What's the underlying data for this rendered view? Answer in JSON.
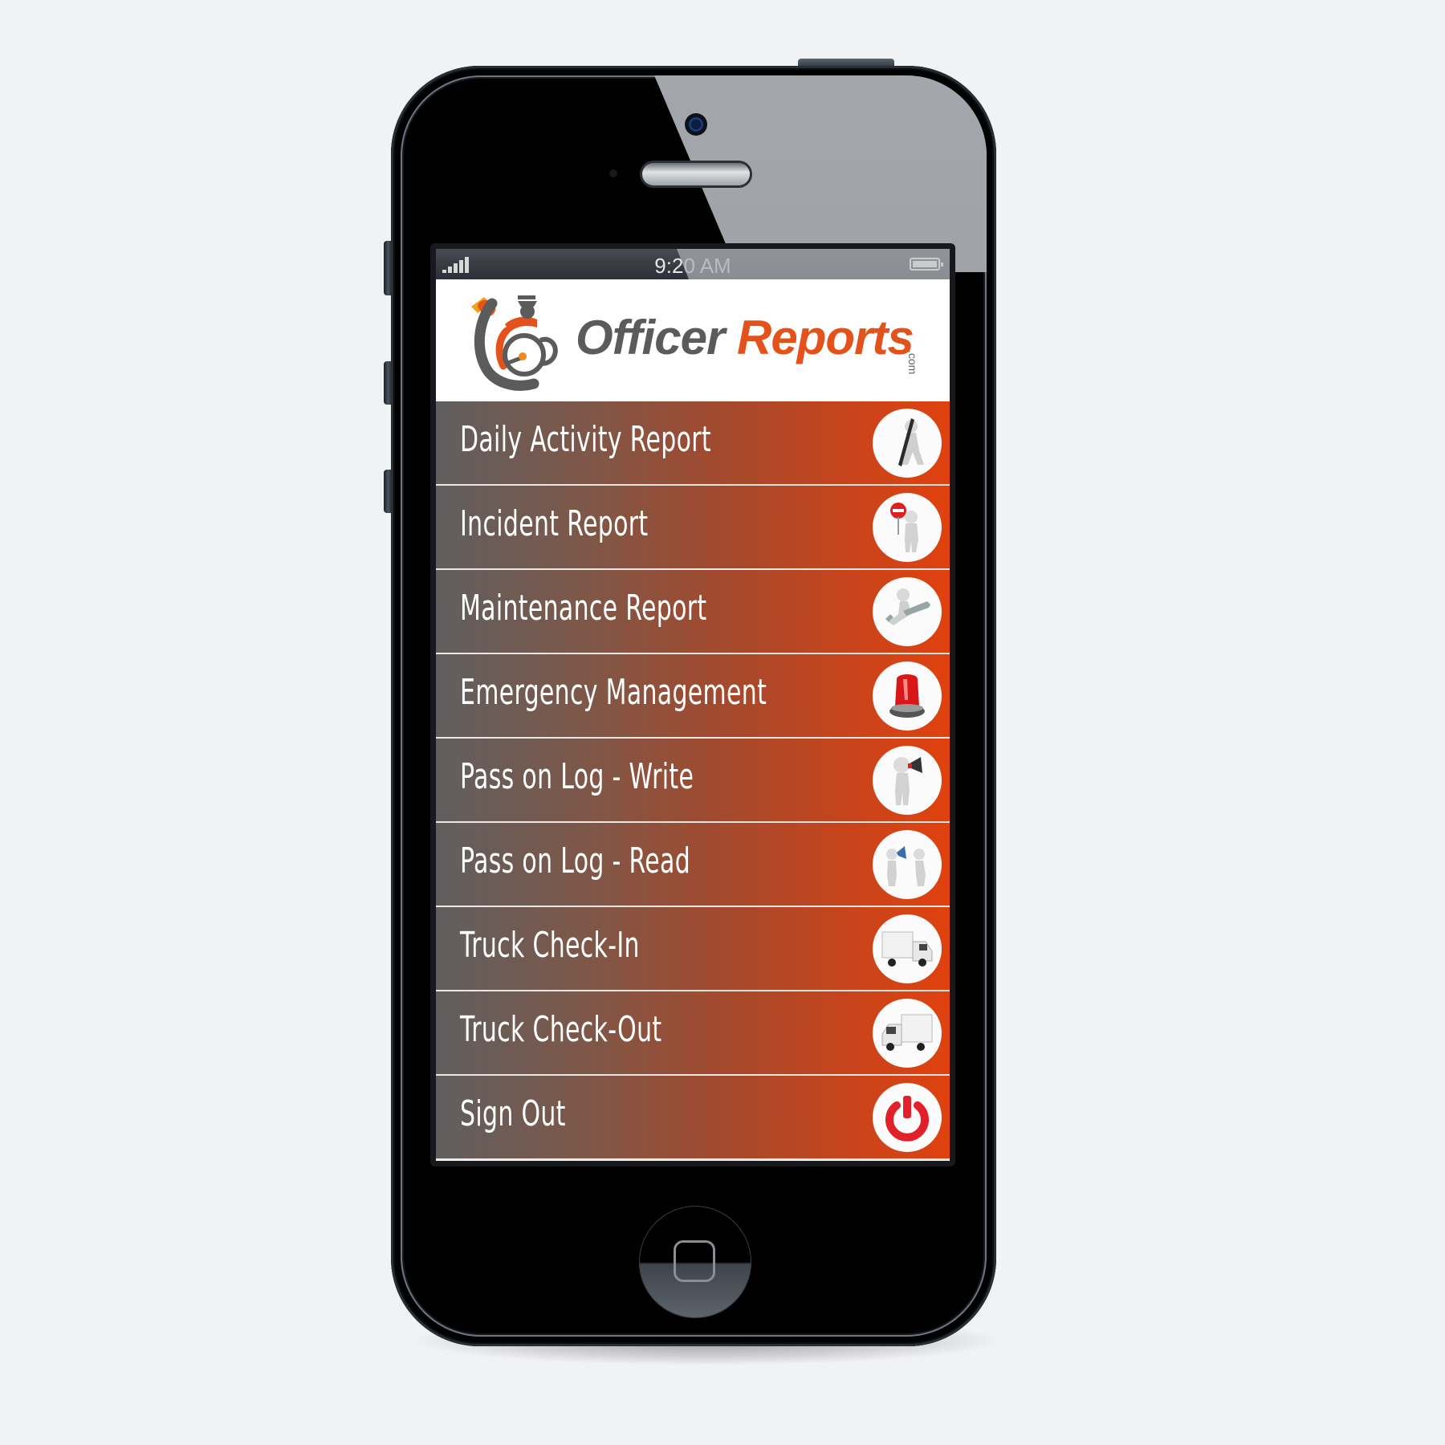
{
  "device": {
    "type": "smartphone"
  },
  "status_bar": {
    "signal_icon": "signal-bars-icon",
    "signal_bars": 5,
    "time": "9:20 AM",
    "battery_icon": "battery-icon"
  },
  "header": {
    "logo_icon": "officer-reports-logo-icon",
    "brand_word_1": "Officer",
    "brand_word_2": "Reports",
    "brand_suffix": ".com",
    "colors": {
      "gray": "#5b5b5b",
      "orange": "#e4521b"
    }
  },
  "menu": {
    "gradient": {
      "start": "#5f5f5f",
      "end": "#e0420e"
    },
    "items": [
      {
        "label": "Daily Activity Report",
        "icon": "figure-with-pen-icon"
      },
      {
        "label": "Incident Report",
        "icon": "figure-with-stop-sign-icon"
      },
      {
        "label": "Maintenance Report",
        "icon": "figure-with-wrench-icon"
      },
      {
        "label": "Emergency Management",
        "icon": "red-siren-light-icon"
      },
      {
        "label": "Pass on Log - Write",
        "icon": "figure-with-megaphone-icon"
      },
      {
        "label": "Pass on Log - Read",
        "icon": "figures-megaphone-listening-icon"
      },
      {
        "label": "Truck Check-In",
        "icon": "truck-icon"
      },
      {
        "label": "Truck Check-Out",
        "icon": "truck-icon"
      },
      {
        "label": "Sign Out",
        "icon": "power-icon"
      }
    ]
  },
  "hardware": {
    "home_button_icon": "home-square-icon"
  }
}
